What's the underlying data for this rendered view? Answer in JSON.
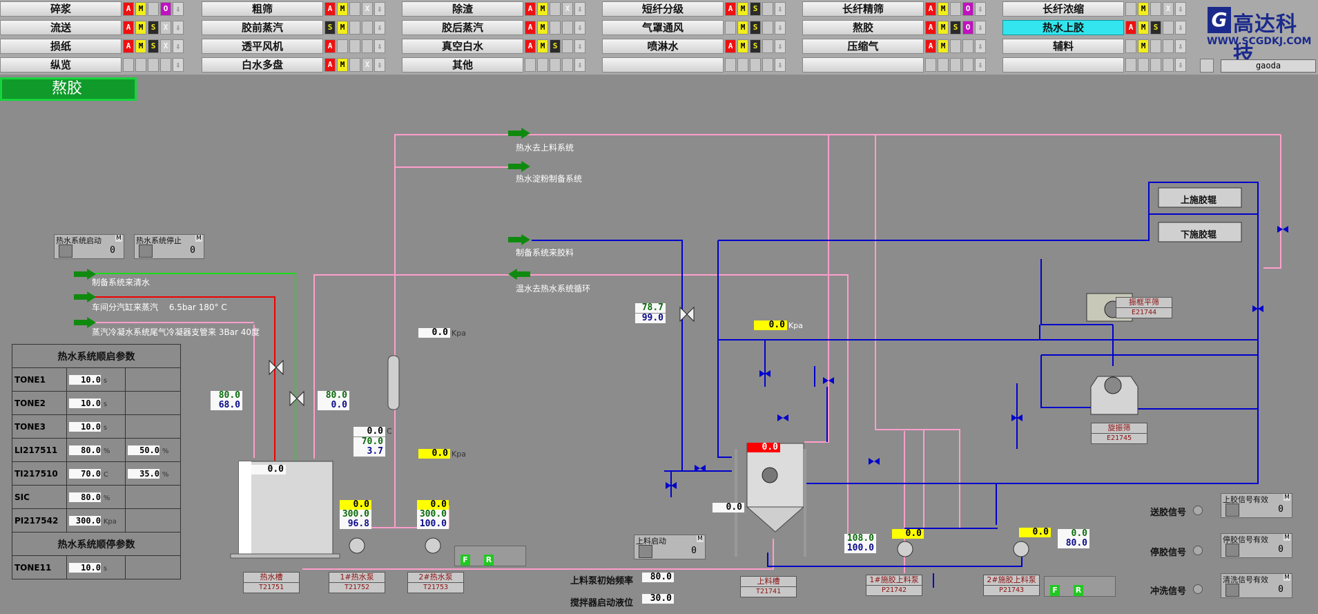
{
  "nav": {
    "row1": [
      {
        "label": "碎浆",
        "ind": [
          "A",
          "M",
          "E",
          "O",
          "D"
        ]
      },
      {
        "label": "粗筛",
        "ind": [
          "A",
          "M",
          "E",
          "X",
          "D"
        ]
      },
      {
        "label": "除渣",
        "ind": [
          "A",
          "M",
          "E",
          "X",
          "D"
        ]
      },
      {
        "label": "短纤分级",
        "ind": [
          "A",
          "M",
          "S",
          "E",
          "D"
        ]
      },
      {
        "label": "长纤精筛",
        "ind": [
          "A",
          "M",
          "E",
          "O",
          "D"
        ]
      },
      {
        "label": "长纤浓缩",
        "ind": [
          "E",
          "M",
          "E",
          "X",
          "D"
        ]
      }
    ],
    "row2": [
      {
        "label": "流送",
        "ind": [
          "A",
          "M",
          "S",
          "X",
          "D"
        ]
      },
      {
        "label": "胶前蒸汽",
        "ind": [
          "S",
          "M",
          "E",
          "E",
          "D"
        ]
      },
      {
        "label": "胶后蒸汽",
        "ind": [
          "A",
          "M",
          "E",
          "E",
          "D"
        ]
      },
      {
        "label": "气罩通风",
        "ind": [
          "E",
          "M",
          "S",
          "E",
          "D"
        ]
      },
      {
        "label": "熬胶",
        "ind": [
          "A",
          "M",
          "S",
          "O",
          "D"
        ]
      },
      {
        "label": "热水上胶",
        "ind": [
          "A",
          "M",
          "S",
          "E",
          "D"
        ],
        "active": true
      }
    ],
    "row3": [
      {
        "label": "损纸",
        "ind": [
          "A",
          "M",
          "S",
          "X",
          "D"
        ]
      },
      {
        "label": "透平风机",
        "ind": [
          "A",
          "E",
          "E",
          "E",
          "D"
        ]
      },
      {
        "label": "真空白水",
        "ind": [
          "A",
          "M",
          "S",
          "E",
          "D"
        ]
      },
      {
        "label": "喷淋水",
        "ind": [
          "A",
          "M",
          "S",
          "E",
          "D"
        ]
      },
      {
        "label": "压缩气",
        "ind": [
          "A",
          "M",
          "E",
          "E",
          "D"
        ]
      },
      {
        "label": "辅料",
        "ind": [
          "E",
          "M",
          "E",
          "E",
          "D"
        ]
      }
    ],
    "row4": [
      {
        "label": "纵览",
        "ind": [
          "E",
          "E",
          "E",
          "E",
          "D"
        ]
      },
      {
        "label": "白水多盘",
        "ind": [
          "A",
          "M",
          "E",
          "X",
          "D"
        ]
      },
      {
        "label": "其他",
        "ind": [
          "E",
          "E",
          "E",
          "E",
          "D"
        ]
      },
      {
        "label": "",
        "ind": [
          "E",
          "E",
          "E",
          "E",
          "D"
        ]
      },
      {
        "label": "",
        "ind": [
          "E",
          "E",
          "E",
          "E",
          "D"
        ]
      },
      {
        "label": "",
        "ind": [
          "E",
          "E",
          "E",
          "E",
          "D"
        ]
      }
    ]
  },
  "indicator_letters": {
    "A": "A",
    "M": "M",
    "S": "S",
    "O": "O",
    "X": "X",
    "D": "⇩",
    "E": ""
  },
  "logo": {
    "mark": "G",
    "name": "高达科技",
    "url": "WWW.SCGDKJ.COM"
  },
  "user": "gaoda",
  "page_title": "熬胶",
  "flows": {
    "hot_to_feed": "热水去上料系统",
    "hot_to_starch": "热水淀粉制备系统",
    "prep_glue": "制备系统来胶料",
    "warm_return": "温水去热水系统循环",
    "prep_clear": "制备系统来清水",
    "steam_in": "车间分汽缸来蒸汽　 6.5bar 180° C",
    "condense_in": "蒸汽冷凝水系统尾气冷凝器支管来 3Bar 40度"
  },
  "hot_start": {
    "label": "热水系统启动",
    "value": "0"
  },
  "hot_stop": {
    "label": "热水系统停止",
    "value": "0"
  },
  "feed_start": {
    "label": "上料启动",
    "value": "0"
  },
  "params": {
    "title_start": "热水系统顺启参数",
    "title_stop": "热水系统顺停参数",
    "rows": [
      {
        "name": "TONE1",
        "v1": "10.0",
        "u1": "s",
        "v2": "",
        "u2": ""
      },
      {
        "name": "TONE2",
        "v1": "10.0",
        "u1": "s",
        "v2": "",
        "u2": ""
      },
      {
        "name": "TONE3",
        "v1": "10.0",
        "u1": "s",
        "v2": "",
        "u2": ""
      },
      {
        "name": "LI217511",
        "v1": "80.0",
        "u1": "%",
        "v2": "50.0",
        "u2": "%"
      },
      {
        "name": "TI217510",
        "v1": "70.0",
        "u1": "C",
        "v2": "35.0",
        "u2": "%"
      },
      {
        "name": "SIC",
        "v1": "80.0",
        "u1": "%",
        "v2": "",
        "u2": ""
      },
      {
        "name": "PI217542",
        "v1": "300.0",
        "u1": "Kpa",
        "v2": "",
        "u2": ""
      }
    ],
    "stop_rows": [
      {
        "name": "TONE11",
        "v1": "10.0",
        "u1": "s"
      }
    ]
  },
  "values": {
    "valve1_sp": "80.0",
    "valve1_pv": "68.0",
    "valve2_sp": "80.0",
    "valve2_pv": "0.0",
    "hot_tank_level": "0.0",
    "pi_top": "0.0",
    "pi_top_unit": "Kpa",
    "hx_temp": "0.0",
    "hx_flow": "70.0",
    "hx_press": "3.7",
    "hx_temp_unit": "C",
    "pi_mid": "0.0",
    "pi_mid_unit": "Kpa",
    "pump1_a": "0.0",
    "pump1_b": "300.0",
    "pump1_c": "96.8",
    "pump2_a": "0.0",
    "pump2_b": "300.0",
    "pump2_c": "100.0",
    "glue_valve_sp": "78.7",
    "glue_valve_pv": "99.0",
    "feed_press": "0.0",
    "feed_press_unit": "Kpa",
    "feed_tank_level": "0.0",
    "feed_tank_temp": "0.0",
    "fp1_a": "108.0",
    "fp1_b": "100.0",
    "fp1_c": "0.0",
    "fp2_c": "0.0",
    "fp2_d": "0.0",
    "fp2_e": "80.0",
    "init_freq": "80.0",
    "mixer_level": "30.0"
  },
  "labels": {
    "init_freq": "上料泵初始频率",
    "mixer_level": "搅拌器启动液位",
    "upper_roll": "上施胶辊",
    "lower_roll": "下施胶辊",
    "send_sig": "送胶信号",
    "stop_sig": "停胶信号",
    "flush_sig": "冲洗信号",
    "send_valid": "上胶信号有效",
    "stop_valid": "停胶信号有效",
    "flush_valid": "清洗信号有效",
    "send_valid_val": "0",
    "stop_valid_val": "0",
    "flush_valid_val": "0"
  },
  "equipment": [
    {
      "name": "热水槽",
      "tag": "T21751"
    },
    {
      "name": "1#热水泵",
      "tag": "T21752"
    },
    {
      "name": "2#热水泵",
      "tag": "T21753"
    },
    {
      "name": "上料槽",
      "tag": "T21741"
    },
    {
      "name": "1#施胶上料泵",
      "tag": "P21742"
    },
    {
      "name": "2#施胶上料泵",
      "tag": "P21743"
    },
    {
      "name": "振框平筛",
      "tag": "E21744"
    },
    {
      "name": "旋振筛",
      "tag": "E21745"
    }
  ],
  "colors": {
    "pink": "#ff9ecb",
    "blue": "#0000cc",
    "green": "#14e014",
    "red": "#ee0000",
    "accent": "#33e5ee"
  }
}
